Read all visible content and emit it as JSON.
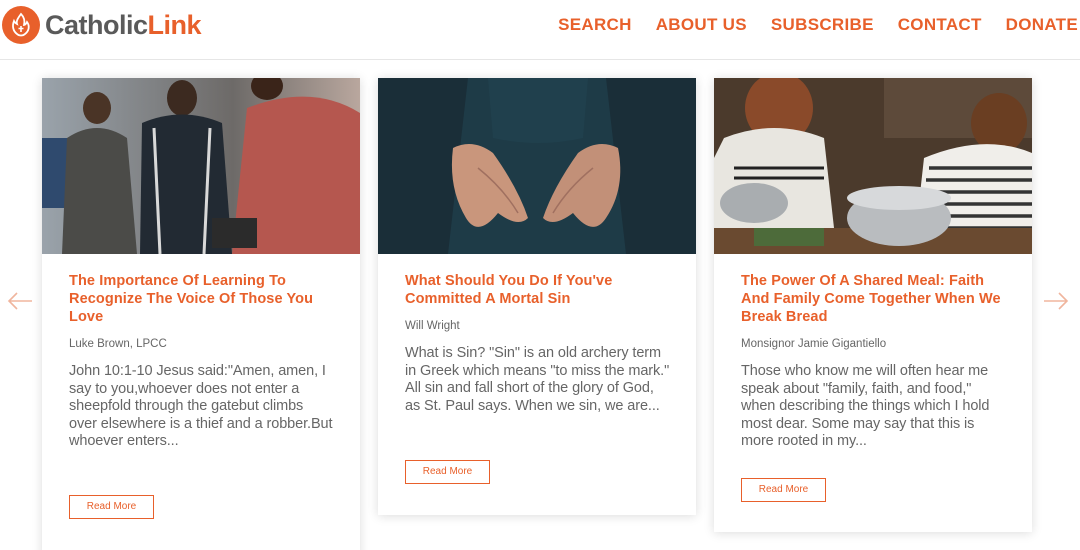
{
  "header": {
    "logo": {
      "part1": "Catholic",
      "part2": "Link"
    },
    "nav": [
      "SEARCH",
      "ABOUT US",
      "SUBSCRIBE",
      "CONTACT",
      "DONATE"
    ]
  },
  "carousel": {
    "prev_icon": "arrow-left-icon",
    "next_icon": "arrow-right-icon",
    "cards": [
      {
        "title": "The Importance Of Learning To Recognize The Voice Of Those You Love",
        "author": "Luke Brown, LPCC",
        "excerpt": "John 10:1-10 Jesus said:\"Amen, amen, I say to you,whoever does not enter a sheepfold through the gatebut climbs over elsewhere is a thief and a robber.But whoever enters...",
        "button": "Read More"
      },
      {
        "title": "What Should You Do If You've Committed A Mortal Sin",
        "author": "Will Wright",
        "excerpt": "What is Sin?  \"Sin\" is an old archery term in Greek which means \"to miss the mark.\" All sin and fall short of the glory of God, as St. Paul says. When we sin, we are...",
        "button": "Read More"
      },
      {
        "title": "The Power Of A Shared Meal: Faith And Family Come Together When We Break Bread",
        "author": "Monsignor Jamie Gigantiello",
        "excerpt": "Those who know me will often hear me speak about \"family, faith, and food,\" when describing the things which I hold most dear. Some may say that this is more rooted in my...",
        "button": "Read More"
      }
    ]
  },
  "colors": {
    "accent": "#e8602b",
    "text": "#666666"
  }
}
